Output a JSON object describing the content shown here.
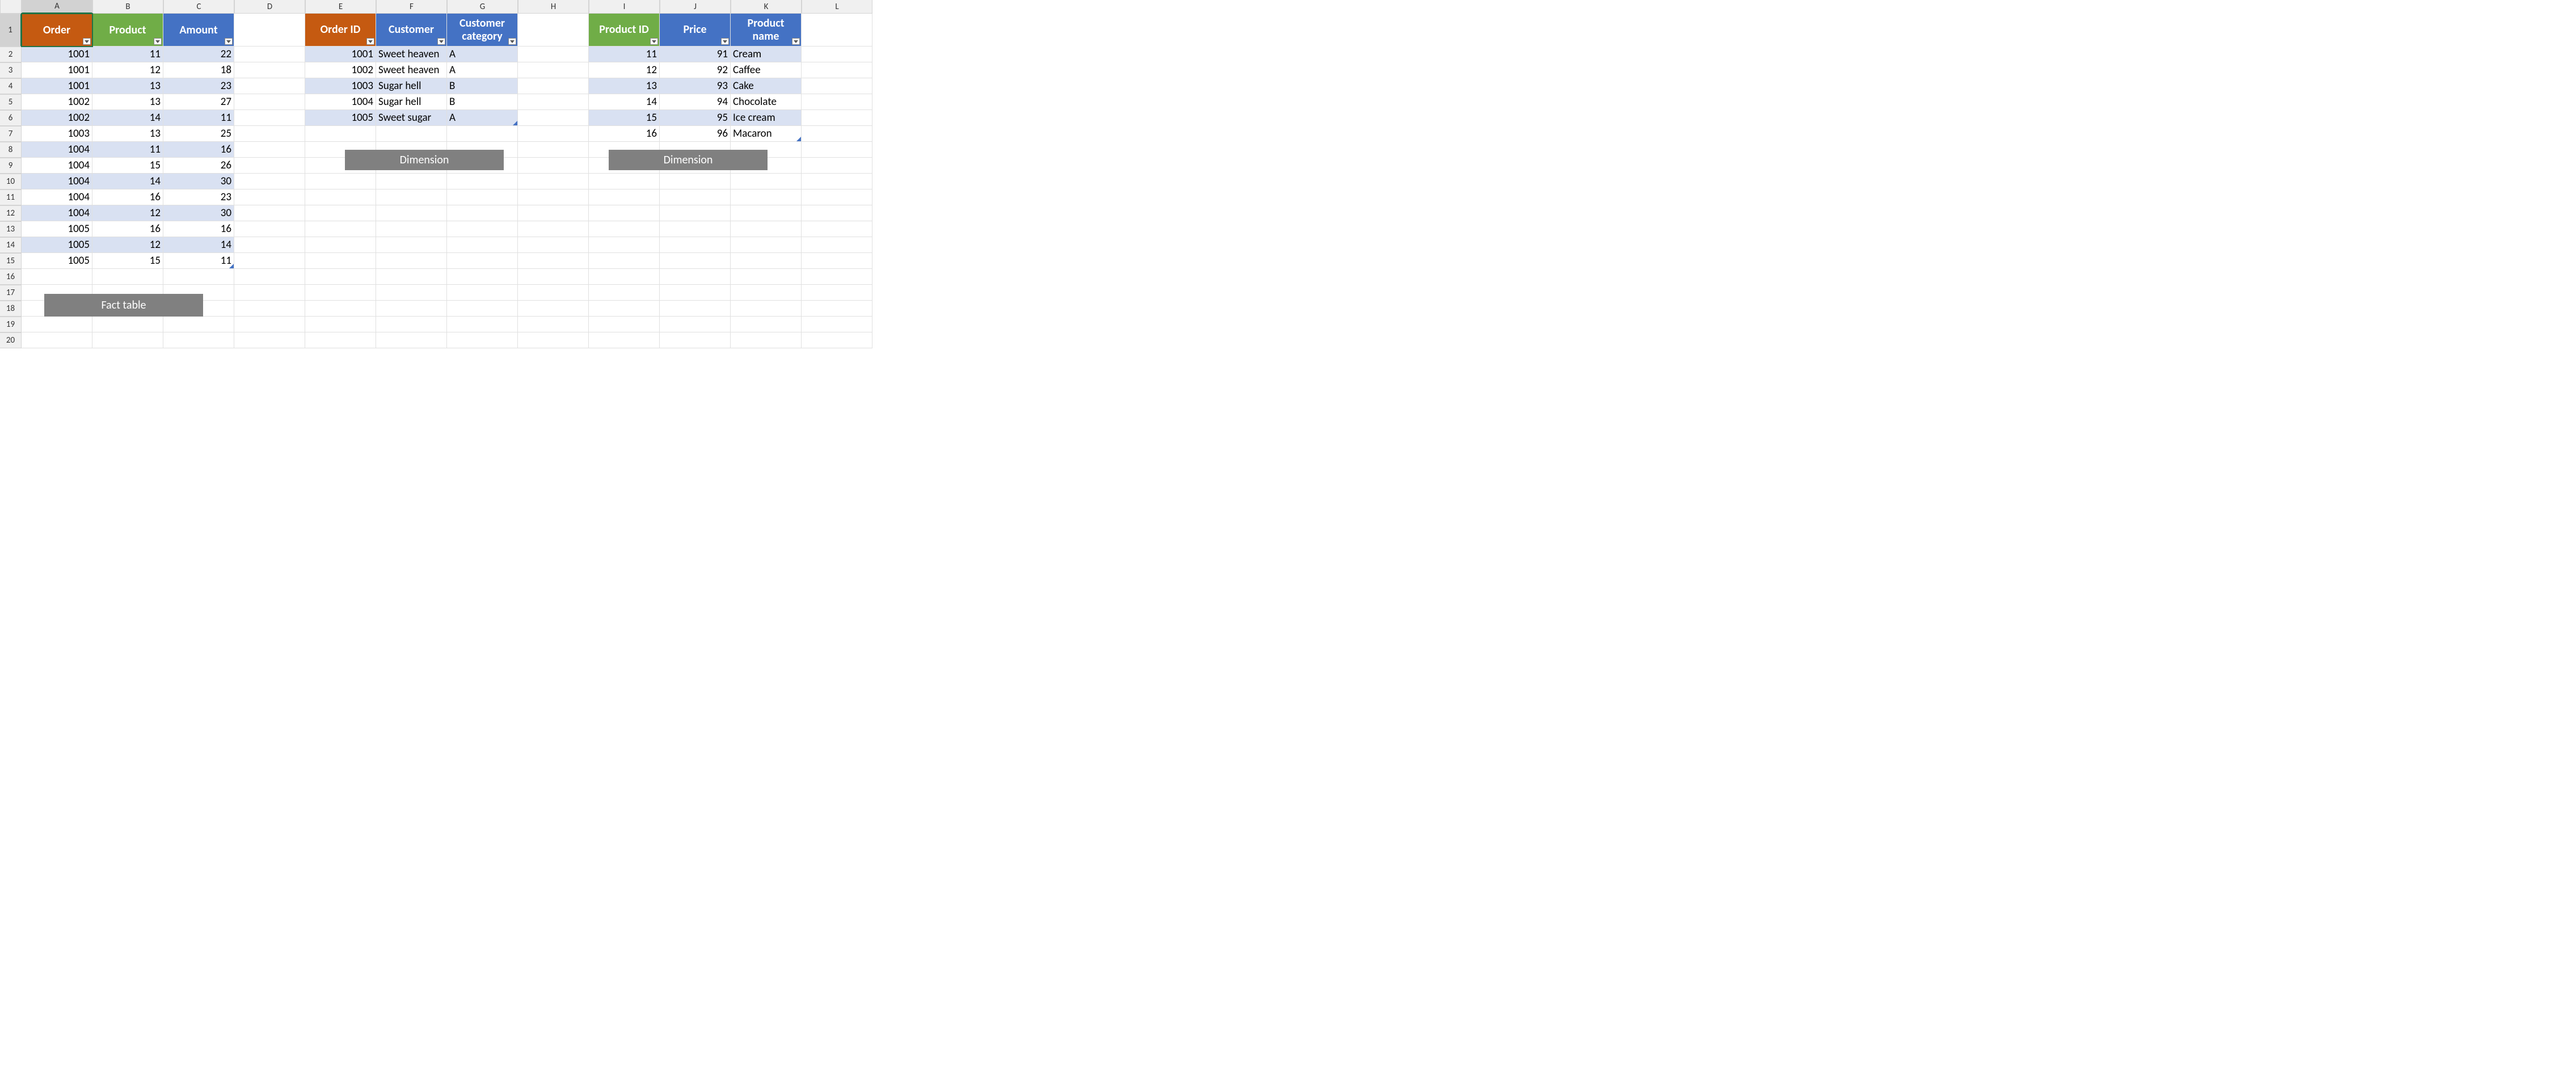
{
  "columns": [
    "A",
    "B",
    "C",
    "D",
    "E",
    "F",
    "G",
    "H",
    "I",
    "J",
    "K",
    "L"
  ],
  "row_count": 20,
  "selected_column": "A",
  "selected_cell": {
    "col": "A",
    "row": 1
  },
  "fact": {
    "headers": [
      "Order",
      "Product",
      "Amount"
    ],
    "header_styles": [
      "orange",
      "green",
      "blue"
    ],
    "rows": [
      [
        1001,
        11,
        22
      ],
      [
        1001,
        12,
        18
      ],
      [
        1001,
        13,
        23
      ],
      [
        1002,
        13,
        27
      ],
      [
        1002,
        14,
        11
      ],
      [
        1003,
        13,
        25
      ],
      [
        1004,
        11,
        16
      ],
      [
        1004,
        15,
        26
      ],
      [
        1004,
        14,
        30
      ],
      [
        1004,
        16,
        23
      ],
      [
        1004,
        12,
        30
      ],
      [
        1005,
        16,
        16
      ],
      [
        1005,
        12,
        14
      ],
      [
        1005,
        15,
        11
      ]
    ]
  },
  "dim_orders": {
    "headers": [
      "Order ID",
      "Customer",
      "Customer category"
    ],
    "header_styles": [
      "orange",
      "blue",
      "blue"
    ],
    "rows": [
      [
        1001,
        "Sweet heaven",
        "A"
      ],
      [
        1002,
        "Sweet heaven",
        "A"
      ],
      [
        1003,
        "Sugar hell",
        "B"
      ],
      [
        1004,
        "Sugar hell",
        "B"
      ],
      [
        1005,
        "Sweet sugar",
        "A"
      ]
    ]
  },
  "dim_products": {
    "headers": [
      "Product ID",
      "Price",
      "Product name"
    ],
    "header_styles": [
      "green",
      "blue",
      "blue"
    ],
    "rows": [
      [
        11,
        91,
        "Cream"
      ],
      [
        12,
        92,
        "Caffee"
      ],
      [
        13,
        93,
        "Cake"
      ],
      [
        14,
        94,
        "Chocolate"
      ],
      [
        15,
        95,
        "Ice cream"
      ],
      [
        16,
        96,
        "Macaron"
      ]
    ]
  },
  "labels": {
    "fact": "Fact table",
    "dim": "Dimension"
  }
}
